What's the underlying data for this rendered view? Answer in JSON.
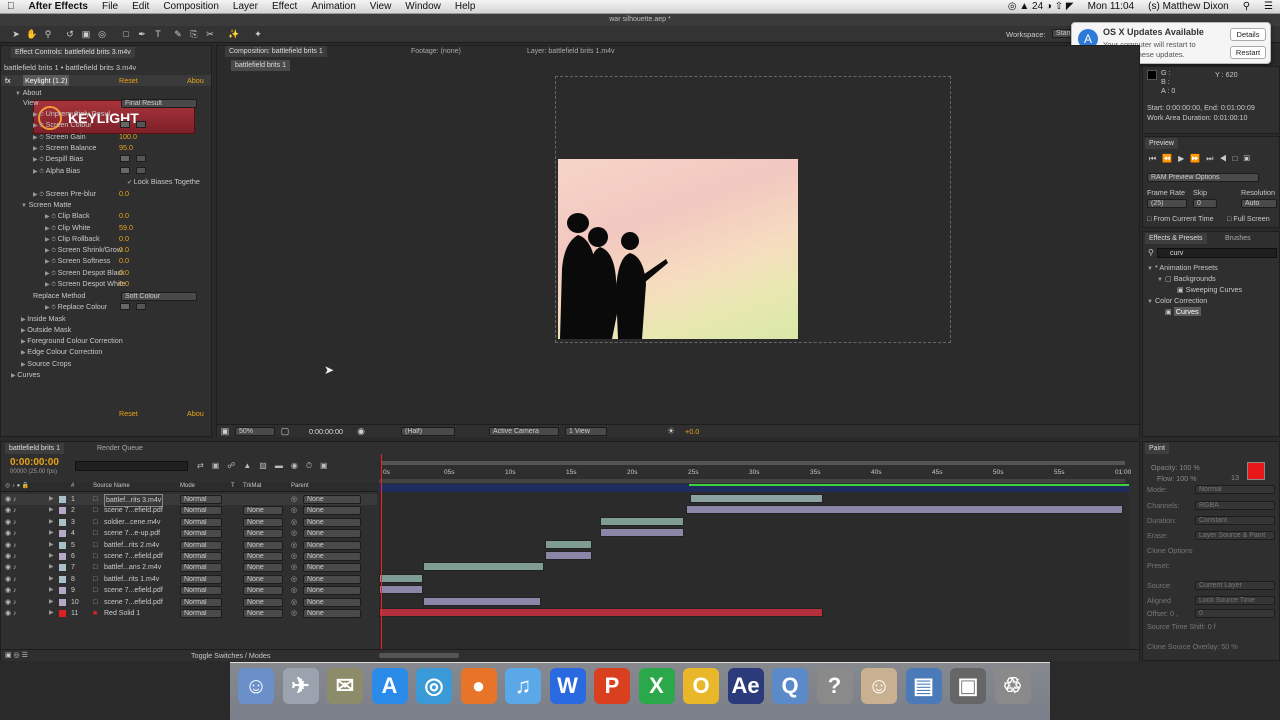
{
  "menubar": {
    "apple": "",
    "items": [
      "After Effects",
      "File",
      "Edit",
      "Composition",
      "Layer",
      "Effect",
      "Animation",
      "View",
      "Window",
      "Help"
    ],
    "status": {
      "battery": "24",
      "time": "Mon 11:04",
      "user": "(s) Matthew Dixon"
    }
  },
  "window_title": "war silhouette.aep *",
  "workspace": {
    "label": "Workspace:",
    "value": "Stan"
  },
  "notification": {
    "title": "OS X Updates Available",
    "body": "Your computer will restart to complete these updates.",
    "details": "Details",
    "restart": "Restart"
  },
  "effect_controls": {
    "tab": "Effect Controls: battlefield brits 3.m4v",
    "subtitle": "battlefield brits 1 • battlefield brits 3.m4v",
    "effect_name": "Keylight (1.2)",
    "reset": "Reset",
    "about": "Abou",
    "about_label": "About",
    "logo_text": "KEYLIGHT",
    "rows": [
      {
        "label": "View",
        "value": "Final Result"
      },
      {
        "label": "Unpremultiply Resul"
      },
      {
        "label": "Screen Colour"
      },
      {
        "label": "Screen Gain",
        "value": "100.0"
      },
      {
        "label": "Screen Balance",
        "value": "95.0"
      },
      {
        "label": "Despill Bias"
      },
      {
        "label": "Alpha Bias"
      },
      {
        "label": "Lock Biases Togethe"
      },
      {
        "label": "Screen Pre-blur",
        "value": "0.0"
      },
      {
        "label": "Screen Matte"
      },
      {
        "label": "Clip Black",
        "value": "0.0"
      },
      {
        "label": "Clip White",
        "value": "59.0"
      },
      {
        "label": "Clip Rollback",
        "value": "0.0"
      },
      {
        "label": "Screen Shrink/Grow",
        "value": "0.0"
      },
      {
        "label": "Screen Softness",
        "value": "0.0"
      },
      {
        "label": "Screen Despot Black",
        "value": "0.0"
      },
      {
        "label": "Screen Despot White",
        "value": "0.0"
      },
      {
        "label": "Replace Method",
        "value": "Soft Colour"
      },
      {
        "label": "Replace Colour"
      },
      {
        "label": "Inside Mask"
      },
      {
        "label": "Outside Mask"
      },
      {
        "label": "Foreground Colour Correction"
      },
      {
        "label": "Edge Colour Correction"
      },
      {
        "label": "Source Crops"
      },
      {
        "label": "Curves"
      }
    ],
    "curves_reset": "Reset",
    "curves_about": "Abou"
  },
  "composition": {
    "tab": "Composition: battlefield brits 1",
    "footage_tab": "Footage: (none)",
    "layer_tab": "Layer: battlefield brits 1.m4v",
    "crumb": "battlefield brits 1",
    "zoom": "50%",
    "timecode": "0:00:00:00",
    "resolution": "(Half)",
    "camera": "Active Camera",
    "views": "1 View",
    "exposure": "+0.0"
  },
  "info": {
    "g": "G :",
    "b": "B :",
    "a": "A : 0",
    "y": "Y : 620",
    "start": "Start: 0:00:00:00, End: 0:01:00:09",
    "work": "Work Area Duration: 0:01:00:10"
  },
  "preview": {
    "tab": "Preview",
    "options": "RAM Preview Options",
    "frame_rate_label": "Frame Rate",
    "skip_label": "Skip",
    "resolution_label": "Resolution",
    "frame_rate": "(25)",
    "skip": "0",
    "resolution": "Auto",
    "from_current": "From Current Time",
    "full_screen": "Full Screen"
  },
  "effects_presets": {
    "tab": "Effects & Presets",
    "tab2": "Brushes",
    "search": "curv",
    "tree": [
      "* Animation Presets",
      "Backgrounds",
      "Sweeping Curves",
      "Color Correction",
      "Curves"
    ]
  },
  "paint": {
    "tab": "Paint",
    "opacity": "Opacity: 100 %",
    "flow": "Flow: 100 %",
    "size": "13",
    "rows": [
      {
        "label": "Mode:",
        "value": "Normal"
      },
      {
        "label": "Channels:",
        "value": "RGBA"
      },
      {
        "label": "Duration:",
        "value": "Constant"
      },
      {
        "label": "Erase:",
        "value": "Layer Source & Paint"
      },
      {
        "label": "Clone Options"
      },
      {
        "label": "Preset:"
      },
      {
        "label": "Source:",
        "value": "Current Layer"
      },
      {
        "label": "Aligned",
        "value": "Lock Source Time"
      },
      {
        "label": "Offset: 0 ,",
        "value": "0"
      },
      {
        "label": "Source Time Shift: 0 f"
      },
      {
        "label": "Clone Source Overlay: 50 %"
      }
    ],
    "fg_color": "#e81818"
  },
  "timeline": {
    "tab": "battlefield brits 1",
    "render_tab": "Render Queue",
    "timecode": "0:00:00:00",
    "fps": "00000 (25.00 fps)",
    "columns": {
      "num": "#",
      "source": "Source Name",
      "mode": "Mode",
      "t": "T",
      "trkmat": "TrkMat",
      "parent": "Parent"
    },
    "ruler": [
      "0s",
      "05s",
      "10s",
      "15s",
      "20s",
      "25s",
      "30s",
      "35s",
      "40s",
      "45s",
      "50s",
      "55s",
      "01:00"
    ],
    "layers": [
      {
        "n": "1",
        "name": "battlef...rits 3.m4v",
        "mode": "Normal",
        "trk": "",
        "parent": "None",
        "color": "#a8c0c8"
      },
      {
        "n": "2",
        "name": "scene 7...efield.pdf",
        "mode": "Normal",
        "trk": "None",
        "parent": "None",
        "color": "#b8a8c8"
      },
      {
        "n": "3",
        "name": "soldier...cene.m4v",
        "mode": "Normal",
        "trk": "None",
        "parent": "None",
        "color": "#a8c0c8"
      },
      {
        "n": "4",
        "name": "scene 7...e-up.pdf",
        "mode": "Normal",
        "trk": "None",
        "parent": "None",
        "color": "#b8a8c8"
      },
      {
        "n": "5",
        "name": "battlef...rits 2.m4v",
        "mode": "Normal",
        "trk": "None",
        "parent": "None",
        "color": "#a8c0c8"
      },
      {
        "n": "6",
        "name": "scene 7...efield.pdf",
        "mode": "Normal",
        "trk": "None",
        "parent": "None",
        "color": "#b8a8c8"
      },
      {
        "n": "7",
        "name": "battlef...ans 2.m4v",
        "mode": "Normal",
        "trk": "None",
        "parent": "None",
        "color": "#a8c0c8"
      },
      {
        "n": "8",
        "name": "battlef...rits 1.m4v",
        "mode": "Normal",
        "trk": "None",
        "parent": "None",
        "color": "#a8c0c8"
      },
      {
        "n": "9",
        "name": "scene 7...efield.pdf",
        "mode": "Normal",
        "trk": "None",
        "parent": "None",
        "color": "#b8a8c8"
      },
      {
        "n": "10",
        "name": "scene 7...efield.pdf",
        "mode": "Normal",
        "trk": "None",
        "parent": "None",
        "color": "#b8a8c8"
      },
      {
        "n": "11",
        "name": "Red Solid 1",
        "mode": "Normal",
        "trk": "None",
        "parent": "None",
        "color": "#e02020"
      }
    ],
    "toggle": "Toggle Switches / Modes"
  },
  "dock": [
    "Finder",
    "Launchpad",
    "Preview",
    "App Store",
    "Safari",
    "Firefox",
    "iTunes",
    "Word",
    "PowerPoint",
    "Excel",
    "Outlook",
    "After Effects",
    "QuickTime",
    "Help",
    "Contacts",
    "Downloads",
    "Screen",
    "Trash"
  ],
  "colors": {
    "accent": "#e8a317",
    "solid_red": "#c8303c",
    "dock": "#3a6fb0"
  }
}
